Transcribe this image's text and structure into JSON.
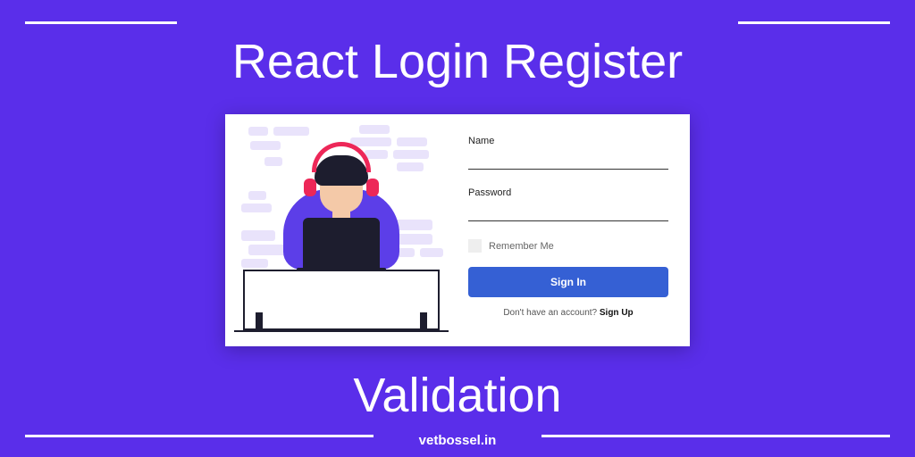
{
  "heading_top": "React Login Register",
  "heading_bottom": "Validation",
  "footer": "vetbossel.in",
  "form": {
    "name_label": "Name",
    "password_label": "Password",
    "remember_label": "Remember Me",
    "signin_button": "Sign In",
    "signup_prompt": "Don't have an account? ",
    "signup_link": "Sign Up"
  },
  "colors": {
    "bg": "#5a2eea",
    "button": "#3560d4",
    "accent": "#ed2758"
  }
}
